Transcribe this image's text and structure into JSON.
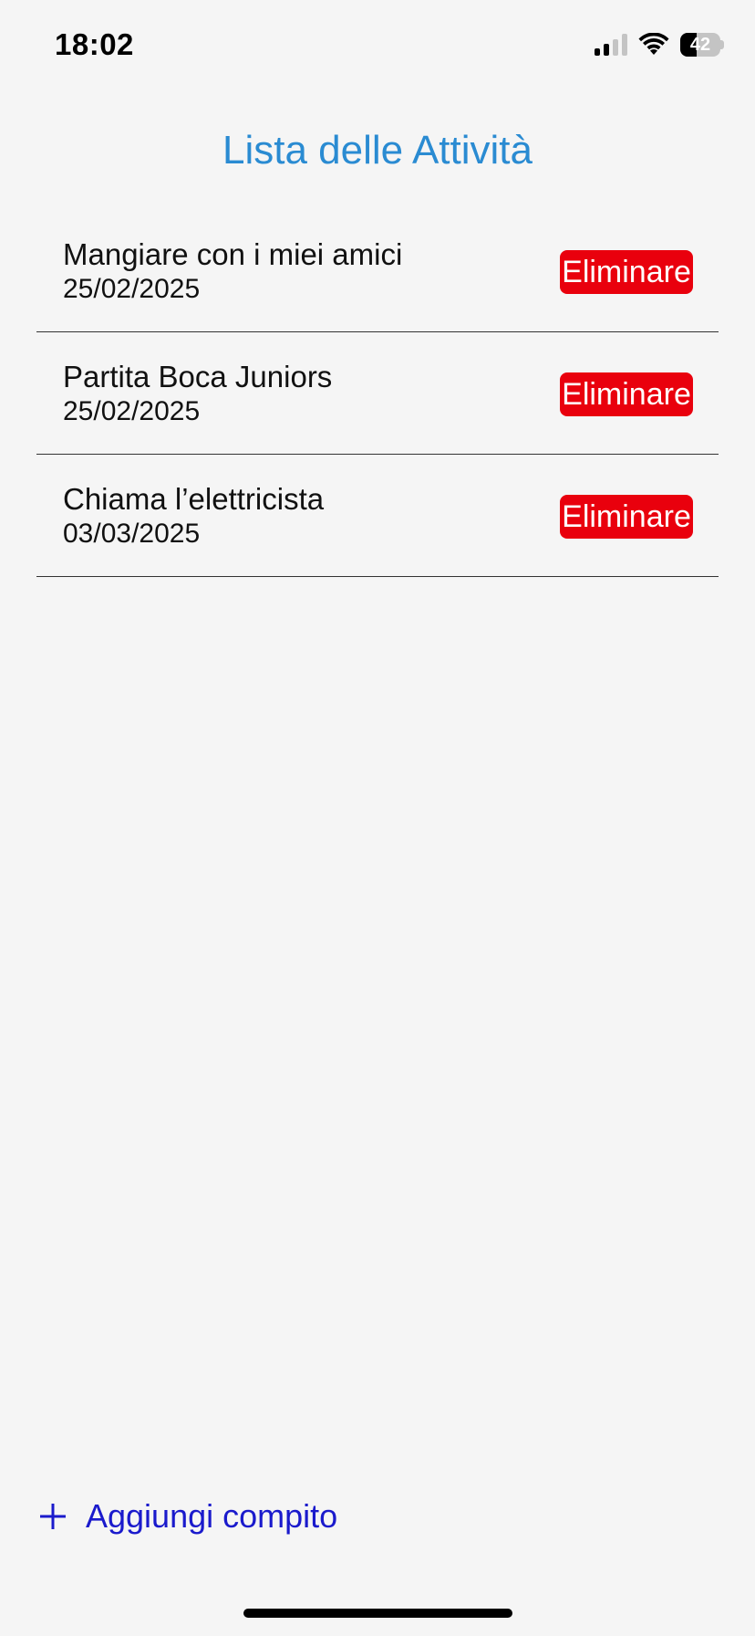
{
  "status_bar": {
    "time": "18:02",
    "battery_level": "42",
    "signal_bars_active": 2,
    "signal_bars_total": 4,
    "battery_fraction": 0.42
  },
  "header": {
    "title": "Lista delle Attività"
  },
  "tasks": [
    {
      "name": "Mangiare con i miei amici",
      "date": "25/02/2025",
      "delete_label": "Eliminare"
    },
    {
      "name": "Partita Boca Juniors",
      "date": "25/02/2025",
      "delete_label": "Eliminare"
    },
    {
      "name": "Chiama l’elettricista",
      "date": "03/03/2025",
      "delete_label": "Eliminare"
    }
  ],
  "footer": {
    "add_label": "Aggiungi compito",
    "add_icon": "plus-icon"
  },
  "colors": {
    "title": "#2a8bd2",
    "delete_button": "#e9000d",
    "add_link": "#1a1acc",
    "background": "#f5f5f5"
  }
}
